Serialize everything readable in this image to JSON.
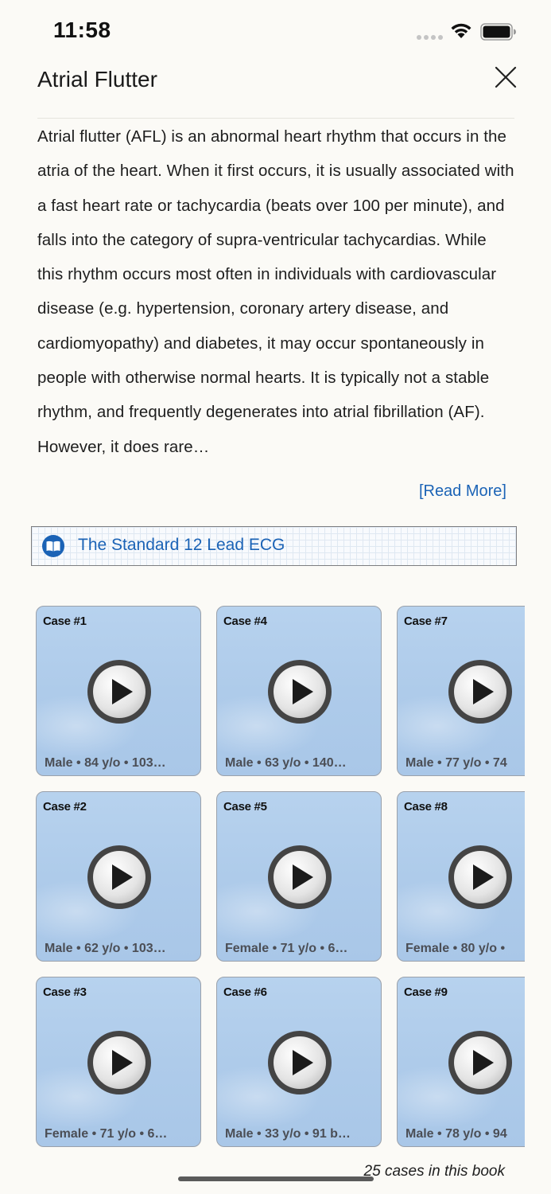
{
  "status": {
    "time": "11:58"
  },
  "header": {
    "title": "Atrial Flutter"
  },
  "description": {
    "text": "Atrial flutter (AFL) is an abnormal heart rhythm that occurs in the atria of the heart. When it first occurs, it is usually associated with a fast heart rate or tachycardia (beats over 100 per minute), and falls into the category of supra-ventricular tachycardias. While this rhythm occurs most often in individuals with cardiovascular disease (e.g. hypertension, coronary artery disease, and cardiomyopathy) and diabetes, it may occur spontaneously in people with otherwise normal hearts. It is typically not a stable rhythm, and frequently degenerates into atrial fibrillation (AF). However, it does rare…",
    "read_more": "[Read More]"
  },
  "book": {
    "label": "The Standard 12 Lead ECG",
    "icon": "book-icon"
  },
  "cases": [
    {
      "title": "Case #1",
      "meta": "Male  •  84 y/o  •  103…"
    },
    {
      "title": "Case #2",
      "meta": "Male  •  62 y/o  •  103…"
    },
    {
      "title": "Case #3",
      "meta": "Female  •  71 y/o  •  6…"
    },
    {
      "title": "Case #4",
      "meta": "Male  •  63 y/o  •  140…"
    },
    {
      "title": "Case #5",
      "meta": "Female  •  71 y/o  •  6…"
    },
    {
      "title": "Case #6",
      "meta": "Male  •  33 y/o  •  91 b…"
    },
    {
      "title": "Case #7",
      "meta": "Male  •  77 y/o  •  74"
    },
    {
      "title": "Case #8",
      "meta": "Female  •  80 y/o  •"
    },
    {
      "title": "Case #9",
      "meta": "Male  •  78 y/o  •  94"
    }
  ],
  "footer": {
    "count_text": "25 cases in this book"
  },
  "colors": {
    "link": "#1b63b6",
    "card_bg": "#aecbea",
    "page_bg": "#fbfaf6"
  }
}
